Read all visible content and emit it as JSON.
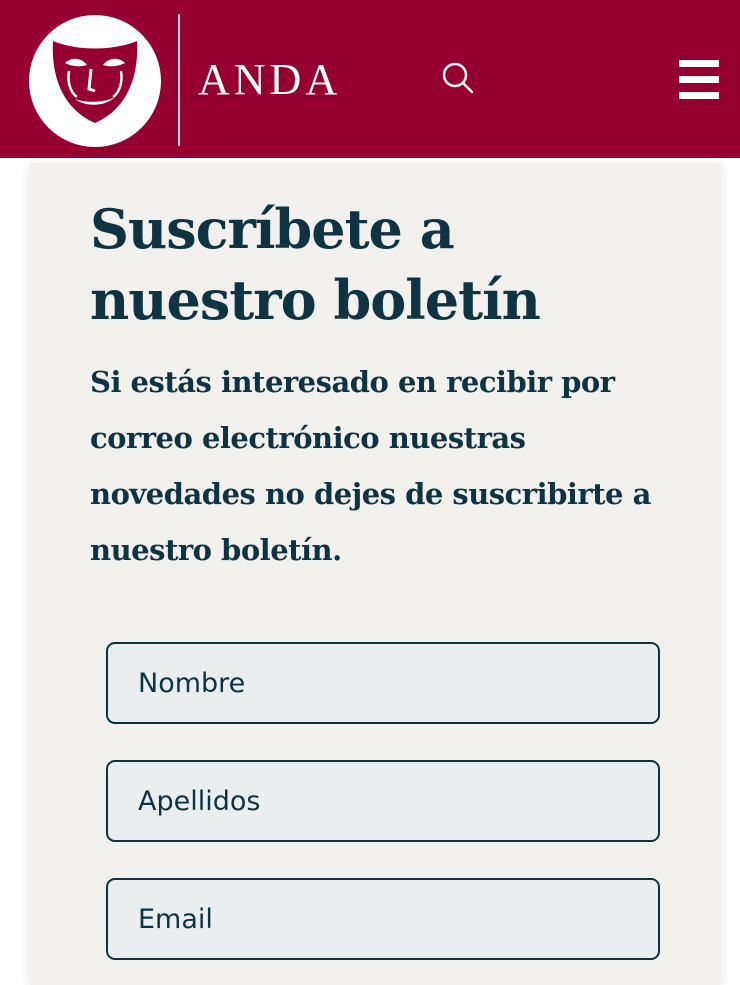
{
  "header": {
    "brand": "ANDA",
    "logo_icon": "theatre-mask-icon",
    "search_icon": "search-icon",
    "menu_icon": "hamburger-menu-icon",
    "background_color": "#960030"
  },
  "newsletter": {
    "title": "Suscríbete a nuestro boletín",
    "description": "Si estás interesado en recibir por correo electrónico nuestras novedades no dejes de suscribirte a nuestro boletín.",
    "fields": [
      {
        "placeholder": "Nombre",
        "value": ""
      },
      {
        "placeholder": "Apellidos",
        "value": ""
      },
      {
        "placeholder": "Email",
        "value": ""
      }
    ],
    "text_color": "#0e3442",
    "panel_color": "#f2f1ee"
  }
}
